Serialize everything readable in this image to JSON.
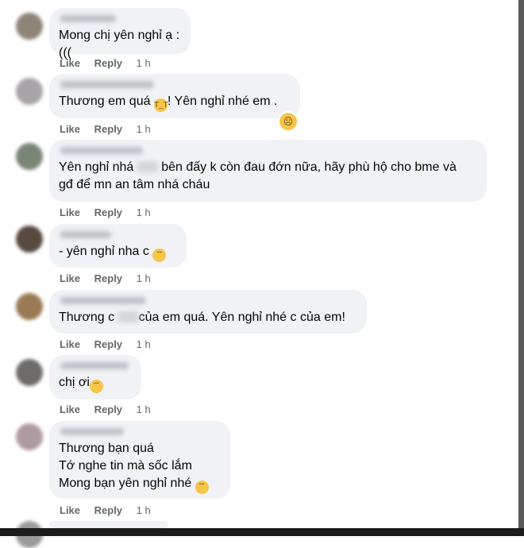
{
  "comments": [
    {
      "text": "Mong chị yên nghỉ ạ :(((",
      "like": "Like",
      "reply": "Reply",
      "time": "1 h"
    },
    {
      "text_before": "Thương em quá ",
      "text_after": "! Yên nghỉ nhé em .",
      "like": "Like",
      "reply": "Reply",
      "time": "1 h",
      "reaction_icon": "sad-face-icon"
    },
    {
      "line1_before": "Yên nghỉ nhá ",
      "line1_after": " bên đấy k còn đau đớn nữa, hãy phù hộ cho bme và",
      "line2": "gđ để mn an tâm nhá cháu",
      "like": "Like",
      "reply": "Reply",
      "time": "1 h"
    },
    {
      "text": "- yên nghỉ nha c ",
      "like": "Like",
      "reply": "Reply",
      "time": "1 h"
    },
    {
      "text_before": "Thương c ",
      "text_after": "của em quá. Yên nghỉ nhé c của em!",
      "like": "Like",
      "reply": "Reply",
      "time": "1 h"
    },
    {
      "text": "chị ơi",
      "like": "Like",
      "reply": "Reply",
      "time": "1 h"
    },
    {
      "line1": "Thương bạn quá",
      "line2": "Tớ nghe tin mà sốc lắm",
      "line3": "Mong bạn yên nghỉ nhé ",
      "like": "Like",
      "reply": "Reply",
      "time": "1 h"
    }
  ],
  "colors": {
    "bubble": "#f0f2f5",
    "action": "#65676b",
    "text": "#050505"
  }
}
